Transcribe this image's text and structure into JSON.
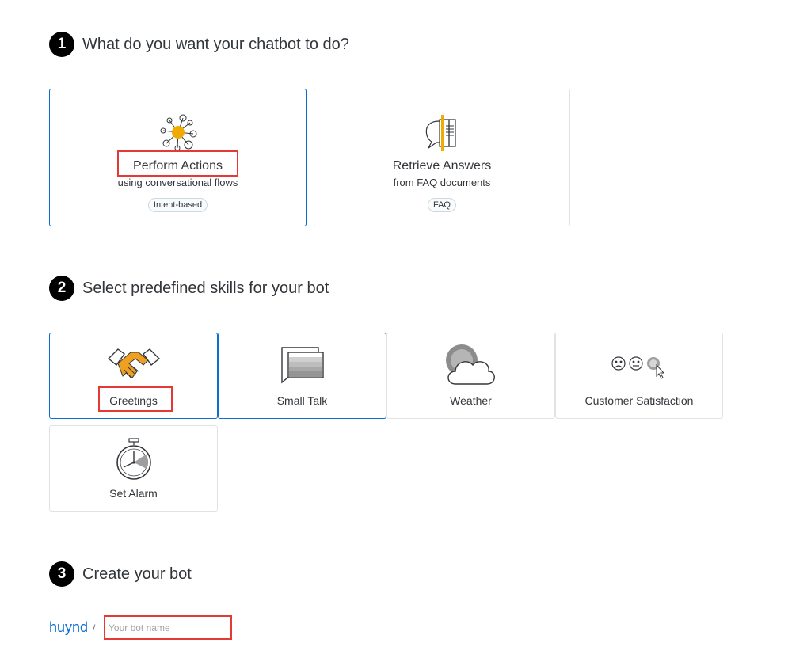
{
  "step1": {
    "number": "1",
    "title": "What do you want your chatbot to do?",
    "options": [
      {
        "title": "Perform Actions",
        "subtitle": "using conversational flows",
        "tag": "Intent-based",
        "icon": "network-nodes-icon",
        "selected": true
      },
      {
        "title": "Retrieve Answers",
        "subtitle": "from FAQ documents",
        "tag": "FAQ",
        "icon": "document-speech-bubble-icon",
        "selected": false
      }
    ]
  },
  "step2": {
    "number": "2",
    "title": "Select predefined skills for your bot",
    "skills": [
      {
        "label": "Greetings",
        "icon": "handshake-icon",
        "selected": true
      },
      {
        "label": "Small Talk",
        "icon": "chat-bubbles-icon",
        "selected": true
      },
      {
        "label": "Weather",
        "icon": "cloud-sun-icon",
        "selected": false
      },
      {
        "label": "Customer Satisfaction",
        "icon": "smiley-faces-icon",
        "selected": false
      },
      {
        "label": "Set Alarm",
        "icon": "stopwatch-icon",
        "selected": false
      }
    ]
  },
  "step3": {
    "number": "3",
    "title": "Create your bot",
    "owner": "huynd",
    "separator": "/",
    "name_placeholder": "Your bot name",
    "name_value": ""
  },
  "colors": {
    "accent": "#0a6ed1",
    "highlight": "#e53935",
    "orange": "#f0ab00"
  }
}
